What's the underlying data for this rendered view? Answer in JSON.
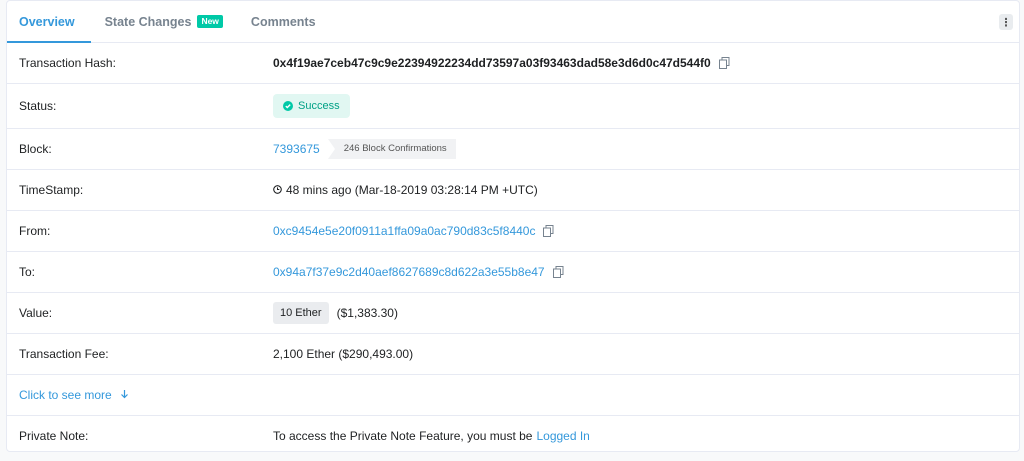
{
  "tabs": [
    {
      "label": "Overview"
    },
    {
      "label": "State Changes",
      "badge": "New"
    },
    {
      "label": "Comments"
    }
  ],
  "more_menu": "⋮",
  "rows": {
    "tx_hash": {
      "label": "Transaction Hash:",
      "value": "0x4f19ae7ceb47c9c9e22394922234dd73597a03f93463dad58e3d6d0c47d544f0"
    },
    "status": {
      "label": "Status:",
      "value": "Success"
    },
    "block": {
      "label": "Block:",
      "value": "7393675",
      "confirmations": "246 Block Confirmations"
    },
    "timestamp": {
      "label": "TimeStamp:",
      "value": "48 mins ago (Mar-18-2019 03:28:14 PM +UTC)"
    },
    "from": {
      "label": "From:",
      "value": "0xc9454e5e20f0911a1ffa09a0ac790d83c5f8440c"
    },
    "to": {
      "label": "To:",
      "value": "0x94a7f37e9c2d40aef8627689c8d622a3e55b8e47"
    },
    "value": {
      "label": "Value:",
      "amount": "10 Ether",
      "usd": "($1,383.30)"
    },
    "fee": {
      "label": "Transaction Fee:",
      "value": "2,100 Ether ($290,493.00)"
    },
    "see_more": {
      "label": "Click to see more"
    },
    "private_note": {
      "label": "Private Note:",
      "text": "To access the Private Note Feature, you must be",
      "link": "Logged In"
    }
  },
  "colors": {
    "accent": "#3498db",
    "success": "#00c9a7"
  }
}
